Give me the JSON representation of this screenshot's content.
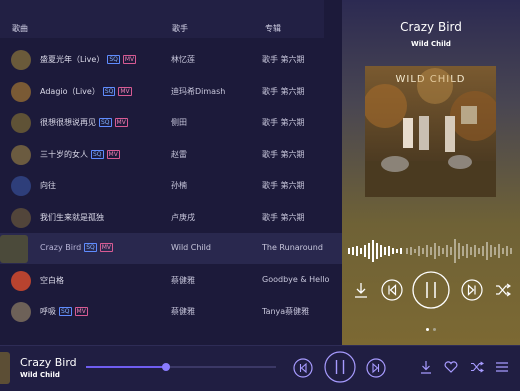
{
  "header": {
    "col_song": "歌曲",
    "col_artist": "歌手",
    "col_album": "专辑"
  },
  "tags": {
    "sq": "SQ",
    "mv": "MV"
  },
  "songs": [
    {
      "title": "盛夏光年（Live）",
      "artist": "林忆莲",
      "album": "歌手 第六期",
      "sq": true,
      "mv": true
    },
    {
      "title": "Adagio（Live）",
      "artist": "迪玛希Dimash",
      "album": "歌手 第六期",
      "sq": true,
      "mv": true
    },
    {
      "title": "很想很想说再见",
      "artist": "侧田",
      "album": "歌手 第六期",
      "sq": true,
      "mv": true
    },
    {
      "title": "三十岁的女人",
      "artist": "赵雷",
      "album": "歌手 第六期",
      "sq": true,
      "mv": true
    },
    {
      "title": "向往",
      "artist": "孙楠",
      "album": "歌手 第六期",
      "sq": false,
      "mv": false
    },
    {
      "title": "我们生来就是孤独",
      "artist": "卢庚戌",
      "album": "歌手 第六期",
      "sq": false,
      "mv": false
    },
    {
      "title": "Crazy Bird",
      "artist": "Wild Child",
      "album": "The Runaround",
      "sq": true,
      "mv": true,
      "active": true
    },
    {
      "title": "空白格",
      "artist": "蔡健雅",
      "album": "Goodbye & Hello",
      "sq": false,
      "mv": false
    },
    {
      "title": "呼吸",
      "artist": "蔡健雅",
      "album": "Tanya蔡健雅",
      "sq": true,
      "mv": true
    }
  ],
  "now_playing": {
    "title": "Crazy Bird",
    "artist": "Wild Child",
    "cover_text": "WILD CHILD"
  },
  "player": {
    "title": "Crazy Bird",
    "artist": "Wild Child",
    "progress": 0.42
  },
  "colors": {
    "accent": "#6f5df0",
    "sq_tag": "#5f8cff",
    "mv_tag": "#d85a93",
    "panel_gold": "#7c6933"
  },
  "icons": [
    "download-icon",
    "prev-icon",
    "pause-icon",
    "next-icon",
    "shuffle-icon",
    "heart-icon",
    "playlist-icon"
  ]
}
